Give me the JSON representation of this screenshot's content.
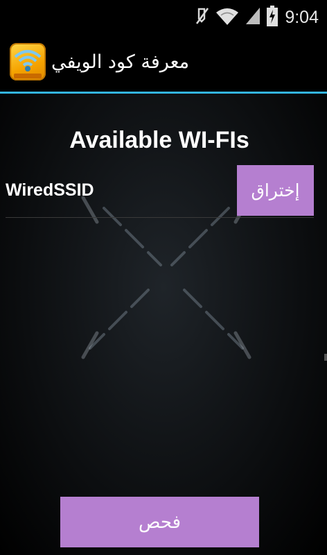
{
  "status_bar": {
    "time": "9:04",
    "icons": [
      "mute-icon",
      "wifi-icon",
      "signal-icon",
      "battery-charging-icon"
    ]
  },
  "action_bar": {
    "app_title": "معرفة كود الويفي",
    "app_icon": "wifi-app-icon",
    "divider_color": "#33b5e5"
  },
  "main": {
    "section_title": "Available WI-FIs",
    "networks": [
      {
        "ssid": "WiredSSID",
        "action_label": "إختراق"
      }
    ],
    "scan_label": "فحص"
  },
  "colors": {
    "accent_button": "#b57fd0",
    "background": "#000000",
    "text": "#ffffff"
  }
}
